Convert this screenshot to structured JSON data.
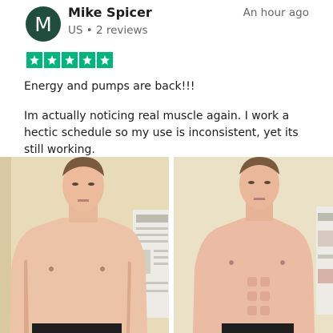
{
  "review": {
    "avatar_letter": "M",
    "author": "Mike Spicer",
    "meta": "US • 2 reviews",
    "time": "An hour ago",
    "rating": 5,
    "star_color": "#00b67a",
    "title": "Energy and pumps are back!!!",
    "body": "Im actually noticing real muscle again. I work a hectic schedule so my use is inconsistent, yet its still working."
  },
  "photos": [
    {
      "icon": "before-photo"
    },
    {
      "icon": "after-photo"
    }
  ]
}
